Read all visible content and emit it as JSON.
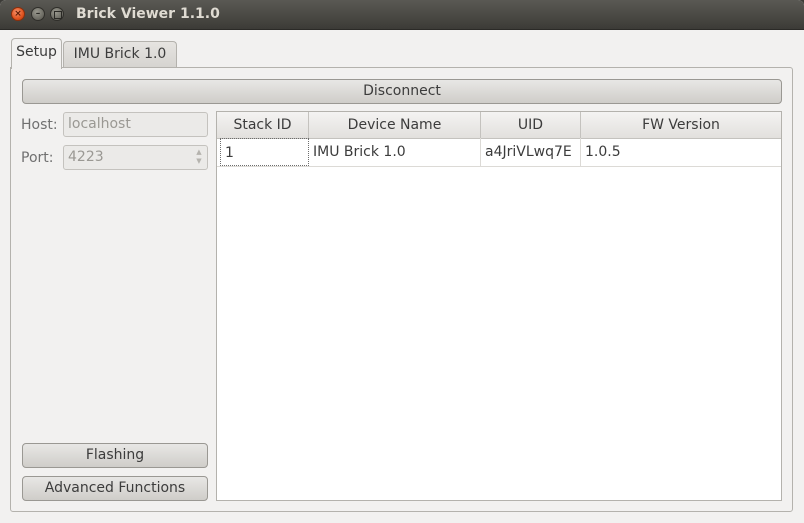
{
  "window": {
    "title": "Brick Viewer 1.1.0"
  },
  "tabs": [
    {
      "label": "Setup",
      "active": true
    },
    {
      "label": "IMU Brick 1.0",
      "active": false
    }
  ],
  "setup": {
    "disconnect_label": "Disconnect",
    "host_label": "Host:",
    "host_value": "localhost",
    "port_label": "Port:",
    "port_value": "4223",
    "flashing_label": "Flashing",
    "advanced_label": "Advanced Functions"
  },
  "table": {
    "headers": [
      "Stack ID",
      "Device Name",
      "UID",
      "FW Version"
    ],
    "rows": [
      [
        "1",
        "IMU Brick 1.0",
        "a4JriVLwq7E",
        "1.0.5"
      ]
    ]
  },
  "colors": {
    "titlebar": "#3c3b37",
    "close_button": "#e0531f",
    "window_bg": "#f2f1f0"
  },
  "icons": {
    "close": "close-icon",
    "minimize": "minimize-icon",
    "maximize": "maximize-icon",
    "spin_up": "spin-up-icon",
    "spin_down": "spin-down-icon"
  }
}
